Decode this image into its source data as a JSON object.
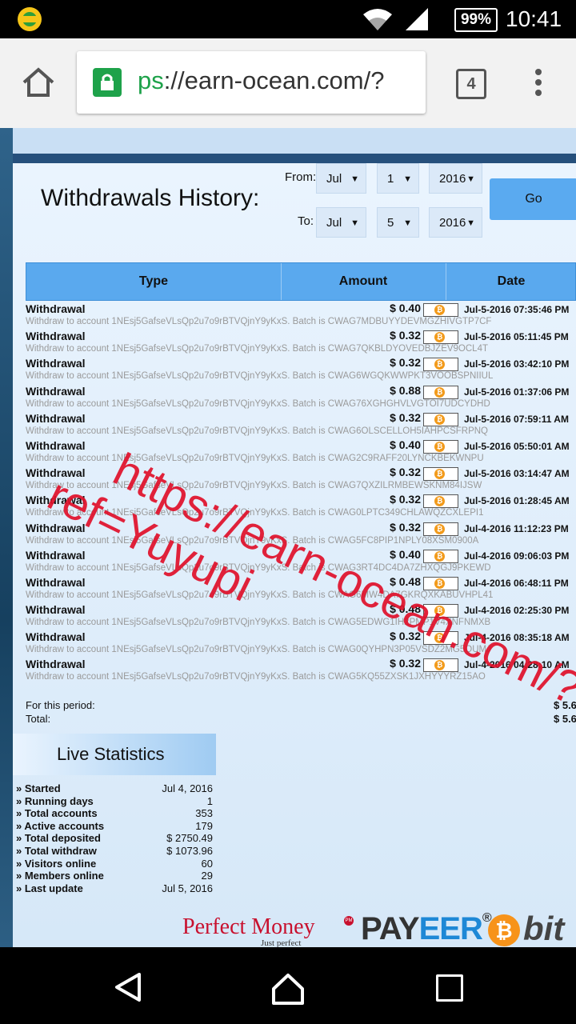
{
  "status_bar": {
    "battery": "99%",
    "time": "10:41"
  },
  "browser": {
    "url_scheme": "ps",
    "url_rest": "://earn-ocean.com/?",
    "tab_count": "4"
  },
  "withdrawals": {
    "title": "Withdrawals History:",
    "from_label": "From:",
    "to_label": "To:",
    "from": {
      "month": "Jul",
      "day": "1",
      "year": "2016"
    },
    "to": {
      "month": "Jul",
      "day": "5",
      "year": "2016"
    },
    "go_label": "Go",
    "columns": [
      "Type",
      "Amount",
      "Date"
    ],
    "rows": [
      {
        "type": "Withdrawal",
        "amount": "$ 0.40",
        "date": "Jul-5-2016 07:35:46 PM",
        "desc": "Withdraw to account 1NEsj5GafseVLsQp2u7o9rBTVQjnY9yKxS. Batch is CWAG7MDBUYYDEVMGZHIVGTP7CF"
      },
      {
        "type": "Withdrawal",
        "amount": "$ 0.32",
        "date": "Jul-5-2016 05:11:45 PM",
        "desc": "Withdraw to account 1NEsj5GafseVLsQp2u7o9rBTVQjnY9yKxS. Batch is CWAG7QKBLDYOVEDBJZEV9OCL4T"
      },
      {
        "type": "Withdrawal",
        "amount": "$ 0.32",
        "date": "Jul-5-2016 03:42:10 PM",
        "desc": "Withdraw to account 1NEsj5GafseVLsQp2u7o9rBTVQjnY9yKxS. Batch is CWAG6WGQKWWPKT3VOOBSPNIIUL"
      },
      {
        "type": "Withdrawal",
        "amount": "$ 0.88",
        "date": "Jul-5-2016 01:37:06 PM",
        "desc": "Withdraw to account 1NEsj5GafseVLsQp2u7o9rBTVQjnY9yKxS. Batch is CWAG76XGHGHVLVGTOI7UDCYDHD"
      },
      {
        "type": "Withdrawal",
        "amount": "$ 0.32",
        "date": "Jul-5-2016 07:59:11 AM",
        "desc": "Withdraw to account 1NEsj5GafseVLsQp2u7o9rBTVQjnY9yKxS. Batch is CWAG6OLSCELLOH5IAHPCSFRPNQ"
      },
      {
        "type": "Withdrawal",
        "amount": "$ 0.40",
        "date": "Jul-5-2016 05:50:01 AM",
        "desc": "Withdraw to account 1NEsj5GafseVLsQp2u7o9rBTVQjnY9yKxS. Batch is CWAG2C9RAFF20LYNCKBEKWNPU"
      },
      {
        "type": "Withdrawal",
        "amount": "$ 0.32",
        "date": "Jul-5-2016 03:14:47 AM",
        "desc": "Withdraw to account 1NEsj5GafseVLsQp2u7o9rBTVQjnY9yKxS. Batch is CWAG7QXZILRMBEWSKNM84IJSW"
      },
      {
        "type": "Withdrawal",
        "amount": "$ 0.32",
        "date": "Jul-5-2016 01:28:45 AM",
        "desc": "Withdraw to account 1NEsj5GafseVLsQp2u7o9rBTVQjnY9yKxS. Batch is CWAG0LPTC349CHLAWQZCXLEPI1"
      },
      {
        "type": "Withdrawal",
        "amount": "$ 0.32",
        "date": "Jul-4-2016 11:12:23 PM",
        "desc": "Withdraw to account 1NEsj5GafseVLsQp2u7o9rBTVQjnY9yKxS. Batch is CWAG5FC8PIP1NPLY08XSM0900A"
      },
      {
        "type": "Withdrawal",
        "amount": "$ 0.40",
        "date": "Jul-4-2016 09:06:03 PM",
        "desc": "Withdraw to account 1NEsj5GafseVLsQp2u7o9rBTVQjnY9yKxS. Batch is CWAG3RT4DC4DA7ZHXQGJ9PKEWD"
      },
      {
        "type": "Withdrawal",
        "amount": "$ 0.48",
        "date": "Jul-4-2016 06:48:11 PM",
        "desc": "Withdraw to account 1NEsj5GafseVLsQp2u7o9rBTVQjnY9yKxS. Batch is CWAG6MW4DA7GKRQXKABUVHPL41"
      },
      {
        "type": "Withdrawal",
        "amount": "$ 0.48",
        "date": "Jul-4-2016 02:25:30 PM",
        "desc": "Withdraw to account 1NEsj5GafseVLsQp2u7o9rBTVQjnY9yKxS. Batch is CWAG5EDWG1IH2PMP1V4XNFNMXB"
      },
      {
        "type": "Withdrawal",
        "amount": "$ 0.32",
        "date": "Jul-4-2016 08:35:18 AM",
        "desc": "Withdraw to account 1NEsj5GafseVLsQp2u7o9rBTVQjnY9yKxS. Batch is CWAG0QYHPN3P05VSDZ2MG5QUMJ"
      },
      {
        "type": "Withdrawal",
        "amount": "$ 0.32",
        "date": "Jul-4-2016 04:28:10 AM",
        "desc": "Withdraw to account 1NEsj5GafseVLsQp2u7o9rBTVQjnY9yKxS. Batch is CWAG5KQ55ZXSK1JXHYYYRZ15AO"
      }
    ],
    "period_label": "For this period:",
    "total_label": "Total:",
    "period_value": "$ 5.6",
    "total_value": "$ 5.6"
  },
  "live_stats": {
    "title": "Live Statistics",
    "items": [
      {
        "k": "» Started",
        "v": "Jul 4, 2016"
      },
      {
        "k": "» Running days",
        "v": "1"
      },
      {
        "k": "» Total accounts",
        "v": "353"
      },
      {
        "k": "» Active accounts",
        "v": "179"
      },
      {
        "k": "» Total deposited",
        "v": "$ 2750.49"
      },
      {
        "k": "» Total withdraw",
        "v": "$ 1073.96"
      },
      {
        "k": "» Visitors online",
        "v": "60"
      },
      {
        "k": "» Members online",
        "v": "29"
      },
      {
        "k": "» Last update",
        "v": "Jul 5, 2016"
      }
    ]
  },
  "logos": {
    "pm": "Perfect Money",
    "pm_tag": "Just perfect",
    "pm_mark": "PM",
    "payeer_a": "PAY",
    "payeer_b": "EER",
    "payeer_reg": "®",
    "btc_symbol": "₿",
    "bit": "bit"
  },
  "watermark": {
    "line1": "https://earn-ocean.com/?",
    "line2": "ref=Yuyupi"
  }
}
